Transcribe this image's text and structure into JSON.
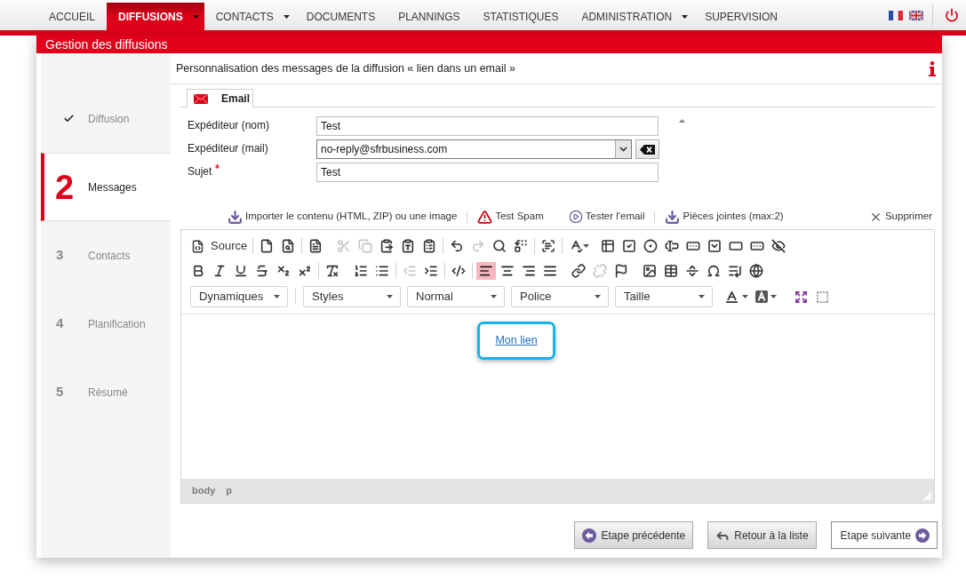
{
  "nav": {
    "items": [
      {
        "label": "ACCUEIL",
        "selected": false,
        "has_menu": false
      },
      {
        "label": "DIFFUSIONS",
        "selected": true,
        "has_menu": true
      },
      {
        "label": "CONTACTS",
        "selected": false,
        "has_menu": true
      },
      {
        "label": "DOCUMENTS",
        "selected": false,
        "has_menu": false
      },
      {
        "label": "PLANNINGS",
        "selected": false,
        "has_menu": false
      },
      {
        "label": "STATISTIQUES",
        "selected": false,
        "has_menu": false
      },
      {
        "label": "ADMINISTRATION",
        "selected": false,
        "has_menu": true
      },
      {
        "label": "SUPERVISION",
        "selected": false,
        "has_menu": false
      }
    ]
  },
  "page_header": {
    "title": "Gestion des diffusions"
  },
  "steps": [
    {
      "label": "Diffusion",
      "done": true,
      "selected": false
    },
    {
      "number": "2",
      "label": "Messages",
      "done": false,
      "selected": true
    },
    {
      "number": "3",
      "label": "Contacts",
      "done": false,
      "selected": false
    },
    {
      "number": "4",
      "label": "Planification",
      "done": false,
      "selected": false
    },
    {
      "number": "5",
      "label": "Résumé",
      "done": false,
      "selected": false
    }
  ],
  "panel": {
    "title": "Personnalisation des messages de la diffusion « lien dans un email »",
    "tabs": [
      {
        "label": "Email",
        "selected": true
      }
    ],
    "fields": [
      {
        "label": "Expéditeur (nom)",
        "value": "Test",
        "kind": "text",
        "required": false
      },
      {
        "label": "Expéditeur (mail)",
        "value": "no-reply@sfrbusiness.com",
        "kind": "select",
        "required": false
      },
      {
        "label": "Sujet",
        "value": "Test",
        "kind": "text",
        "required": true
      }
    ],
    "actions": [
      {
        "label": "Importer le contenu (HTML, ZIP) ou une image"
      },
      {
        "label": "Test Spam"
      },
      {
        "label": "Tester l'email"
      },
      {
        "label": "Pièces jointes (max:2)"
      },
      {
        "label": "Supprimer"
      }
    ],
    "editor": {
      "source_label": "Source",
      "tools": {
        "cut": {
          "disabled": true
        },
        "copy": {
          "disabled": true
        },
        "redo": {
          "disabled": true
        },
        "outdent": {
          "disabled": true
        },
        "unlink": {
          "disabled": true
        }
      },
      "alignment": [
        {
          "selected": true
        },
        {
          "selected": false
        },
        {
          "selected": false
        },
        {
          "selected": false
        }
      ],
      "combos": [
        {
          "label": "Dynamiques"
        },
        {
          "label": "Styles"
        },
        {
          "label": "Normal"
        },
        {
          "label": "Police"
        },
        {
          "label": "Taille"
        }
      ],
      "content": {
        "link": "Mon lien",
        "highlighted": true
      },
      "path": [
        "body",
        "p"
      ]
    },
    "buttons": [
      {
        "label": "Etape précédente",
        "kind": "previous"
      },
      {
        "label": "Retour à la liste",
        "kind": "return"
      },
      {
        "label": "Etape suivante",
        "kind": "next"
      }
    ]
  }
}
